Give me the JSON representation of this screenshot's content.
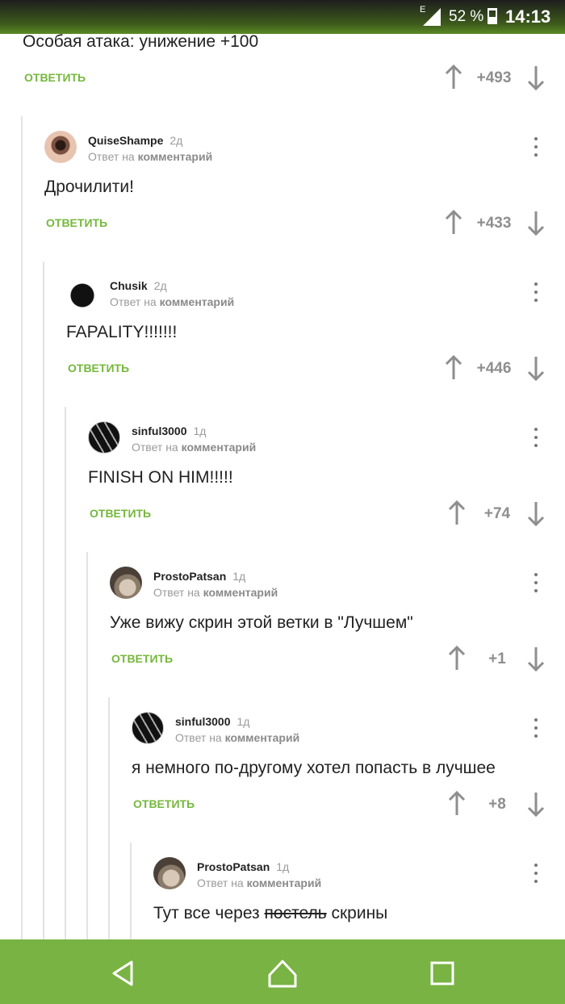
{
  "status_bar": {
    "network": "E",
    "battery": "52 %",
    "time": "14:13"
  },
  "top_comment": {
    "text": "Особая атака: унижение +100",
    "reply_label": "ОТВЕТИТЬ",
    "score": "+493"
  },
  "comments": [
    {
      "author": "QuiseShampe",
      "age": "2д",
      "reply_prefix": "Ответ на",
      "reply_target": "комментарий",
      "text": "Дрочилити!",
      "reply_label": "ОТВЕТИТЬ",
      "score": "+433"
    },
    {
      "author": "Chusik",
      "age": "2д",
      "reply_prefix": "Ответ на",
      "reply_target": "комментарий",
      "text": "FAPALITY!!!!!!!",
      "reply_label": "ОТВЕТИТЬ",
      "score": "+446"
    },
    {
      "author": "sinful3000",
      "age": "1д",
      "reply_prefix": "Ответ на",
      "reply_target": "комментарий",
      "text": "FINISH ON HIM!!!!!",
      "reply_label": "ОТВЕТИТЬ",
      "score": "+74"
    },
    {
      "author": "ProstoPatsan",
      "age": "1д",
      "reply_prefix": "Ответ на",
      "reply_target": "комментарий",
      "text": "Уже вижу скрин этой ветки в \"Лучшем\"",
      "reply_label": "ОТВЕТИТЬ",
      "score": "+1"
    },
    {
      "author": "sinful3000",
      "age": "1д",
      "reply_prefix": "Ответ на",
      "reply_target": "комментарий",
      "text": "я немного по-другому хотел попасть в лучшее",
      "reply_label": "ОТВЕТИТЬ",
      "score": "+8"
    },
    {
      "author": "ProstoPatsan",
      "age": "1д",
      "reply_prefix": "Ответ на",
      "reply_target": "комментарий",
      "text_before": "Тут все через",
      "text_struck": "постель",
      "text_after": "скрины"
    }
  ],
  "icons": {
    "upvote": "arrow-up-icon",
    "downvote": "arrow-down-icon",
    "menu": "more-vertical-icon",
    "nav_back": "back-triangle-icon",
    "nav_home": "home-icon",
    "nav_recents": "recents-square-icon"
  },
  "colors": {
    "accent": "#75b83c",
    "navbar": "#79b343",
    "score": "#8e8e8e"
  }
}
